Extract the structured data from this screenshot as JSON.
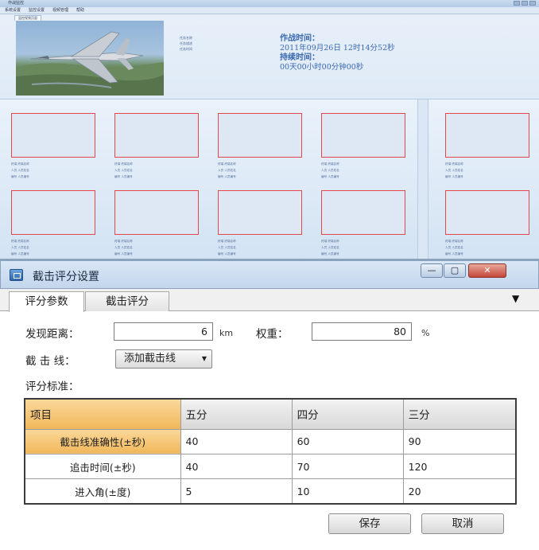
{
  "app": {
    "window_title": "作战监控",
    "menu": [
      "系统设置",
      "监控设置",
      "视频管理",
      "帮助"
    ],
    "tab": "监控视频页面",
    "mission_info": [
      "任务名称",
      "任务描述",
      "任务时间"
    ],
    "battle_time": {
      "label": "作战时间：",
      "value": "2011年09月26日  12时14分52秒"
    },
    "duration": {
      "label": "持续时间：",
      "value": "00天00小时00分钟00秒"
    },
    "video_cells": [
      {
        "meta": [
          "终端  终端名称",
          "人员  人员姓名",
          "编号  人员编号"
        ]
      },
      {
        "meta": [
          "终端  终端名称",
          "人员  人员姓名",
          "编号  人员编号"
        ]
      },
      {
        "meta": [
          "终端  终端名称",
          "人员  人员姓名",
          "编号  人员编号"
        ]
      },
      {
        "meta": [
          "终端  终端名称",
          "人员  人员姓名",
          "编号  人员编号"
        ]
      },
      {
        "meta": [
          "终端  终端名称",
          "人员  人员姓名",
          "编号  人员编号"
        ]
      },
      {
        "meta": [
          "终端  终端名称",
          "人员  人员姓名",
          "编号  人员编号"
        ]
      },
      {
        "meta": [
          "终端  终端名称",
          "人员  人员姓名",
          "编号  人员编号"
        ]
      },
      {
        "meta": [
          "终端  终端名称",
          "人员  人员姓名",
          "编号  人员编号"
        ]
      },
      {
        "meta": [
          "终端  终端名称",
          "人员  人员姓名",
          "编号  人员编号"
        ]
      },
      {
        "meta": [
          "终端  终端名称",
          "人员  人员姓名",
          "编号  人员编号"
        ]
      }
    ]
  },
  "dialog": {
    "title": "截击评分设置",
    "window_buttons": {
      "minimize": "—",
      "maximize": "▢",
      "close": "✕"
    },
    "tabs": [
      "评分参数",
      "截击评分"
    ],
    "tab_dropdown": "▼",
    "discover_distance": {
      "label": "发现距离：",
      "value": "6",
      "unit": "km"
    },
    "weight": {
      "label": "权重：",
      "value": "80",
      "unit": "%"
    },
    "intercept_line": {
      "label": "截 击 线：",
      "combo": "添加截击线",
      "combo_arrow": "▼"
    },
    "standard_label": "评分标准：",
    "table": {
      "headers": [
        "项目",
        "五分",
        "四分",
        "三分"
      ],
      "rows": [
        {
          "item": "截击线准确性(±秒)",
          "values": [
            "40",
            "60",
            "90"
          ]
        },
        {
          "item": "追击时间(±秒)",
          "values": [
            "40",
            "70",
            "120"
          ]
        },
        {
          "item": "进入角(±度)",
          "values": [
            "5",
            "10",
            "20"
          ]
        }
      ]
    },
    "buttons": {
      "save": "保存",
      "cancel": "取消"
    }
  }
}
